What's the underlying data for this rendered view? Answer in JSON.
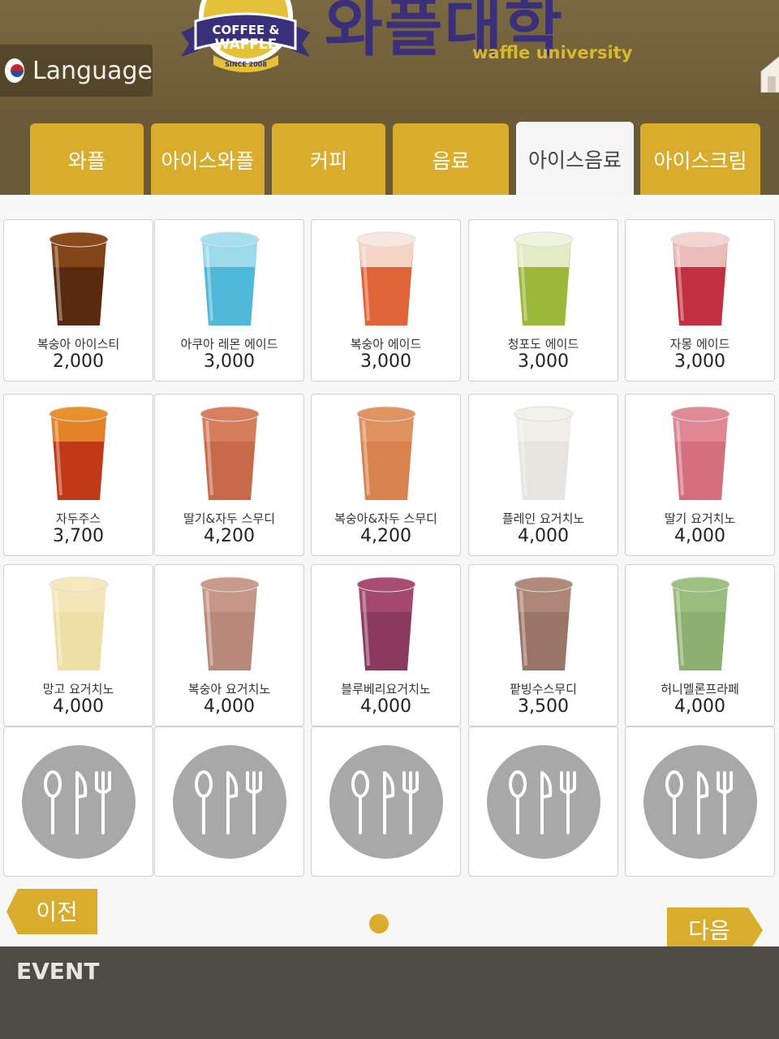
{
  "header": {
    "language_label": "Language",
    "brand_kr": "와플대학",
    "brand_en": "waffle university",
    "logo_line1": "COFFEE &",
    "logo_line2": "WAFFLE",
    "logo_since": "SINCE 2008"
  },
  "tabs": [
    {
      "label": "와플",
      "active": false
    },
    {
      "label": "아이스와플",
      "active": false
    },
    {
      "label": "커피",
      "active": false
    },
    {
      "label": "음료",
      "active": false
    },
    {
      "label": "아이스음료",
      "active": true
    },
    {
      "label": "아이스크림",
      "active": false
    }
  ],
  "items": [
    {
      "name": "복숭아 아이스티",
      "price": "2,000",
      "color": "#5a2a10",
      "top": "#8a4a1a"
    },
    {
      "name": "아쿠아 레몬 에이드",
      "price": "3,000",
      "color": "#4fb8d8",
      "top": "#a8dfee"
    },
    {
      "name": "복숭아 에이드",
      "price": "3,000",
      "color": "#e0643a",
      "top": "#f6e8de"
    },
    {
      "name": "청포도 에이드",
      "price": "3,000",
      "color": "#9cb83a",
      "top": "#eef3dc"
    },
    {
      "name": "자몽 에이드",
      "price": "3,000",
      "color": "#c23040",
      "top": "#f2d4d0"
    },
    {
      "name": "자두주스",
      "price": "3,700",
      "color": "#c03a18",
      "top": "#e8902a"
    },
    {
      "name": "딸기&자두 스무디",
      "price": "4,200",
      "color": "#c86a4a",
      "top": "#d8805e"
    },
    {
      "name": "복숭아&자두 스무디",
      "price": "4,200",
      "color": "#d8824e",
      "top": "#e09462"
    },
    {
      "name": "플레인 요거치노",
      "price": "4,000",
      "color": "#e6e4de",
      "top": "#f2f0ec"
    },
    {
      "name": "딸기 요거치노",
      "price": "4,000",
      "color": "#d4707e",
      "top": "#e08a96"
    },
    {
      "name": "망고 요거치노",
      "price": "4,000",
      "color": "#eedfa6",
      "top": "#f4e8bc"
    },
    {
      "name": "복숭아 요거치노",
      "price": "4,000",
      "color": "#b8887a",
      "top": "#c89a8a"
    },
    {
      "name": "블루베리요거치노",
      "price": "4,000",
      "color": "#8a3a5e",
      "top": "#a84c70"
    },
    {
      "name": "팥빙수스무디",
      "price": "3,500",
      "color": "#9a7466",
      "top": "#b08a7a"
    },
    {
      "name": "허니멜론프라페",
      "price": "4,000",
      "color": "#8cb070",
      "top": "#9cc080"
    }
  ],
  "empty_slots": 5,
  "nav": {
    "prev_label": "이전",
    "next_label": "다음"
  },
  "footer": {
    "event_label": "EVENT"
  },
  "colors": {
    "accent": "#d9ac2c",
    "brand_purple": "#3a2f7a",
    "header": "#6e5c36"
  }
}
